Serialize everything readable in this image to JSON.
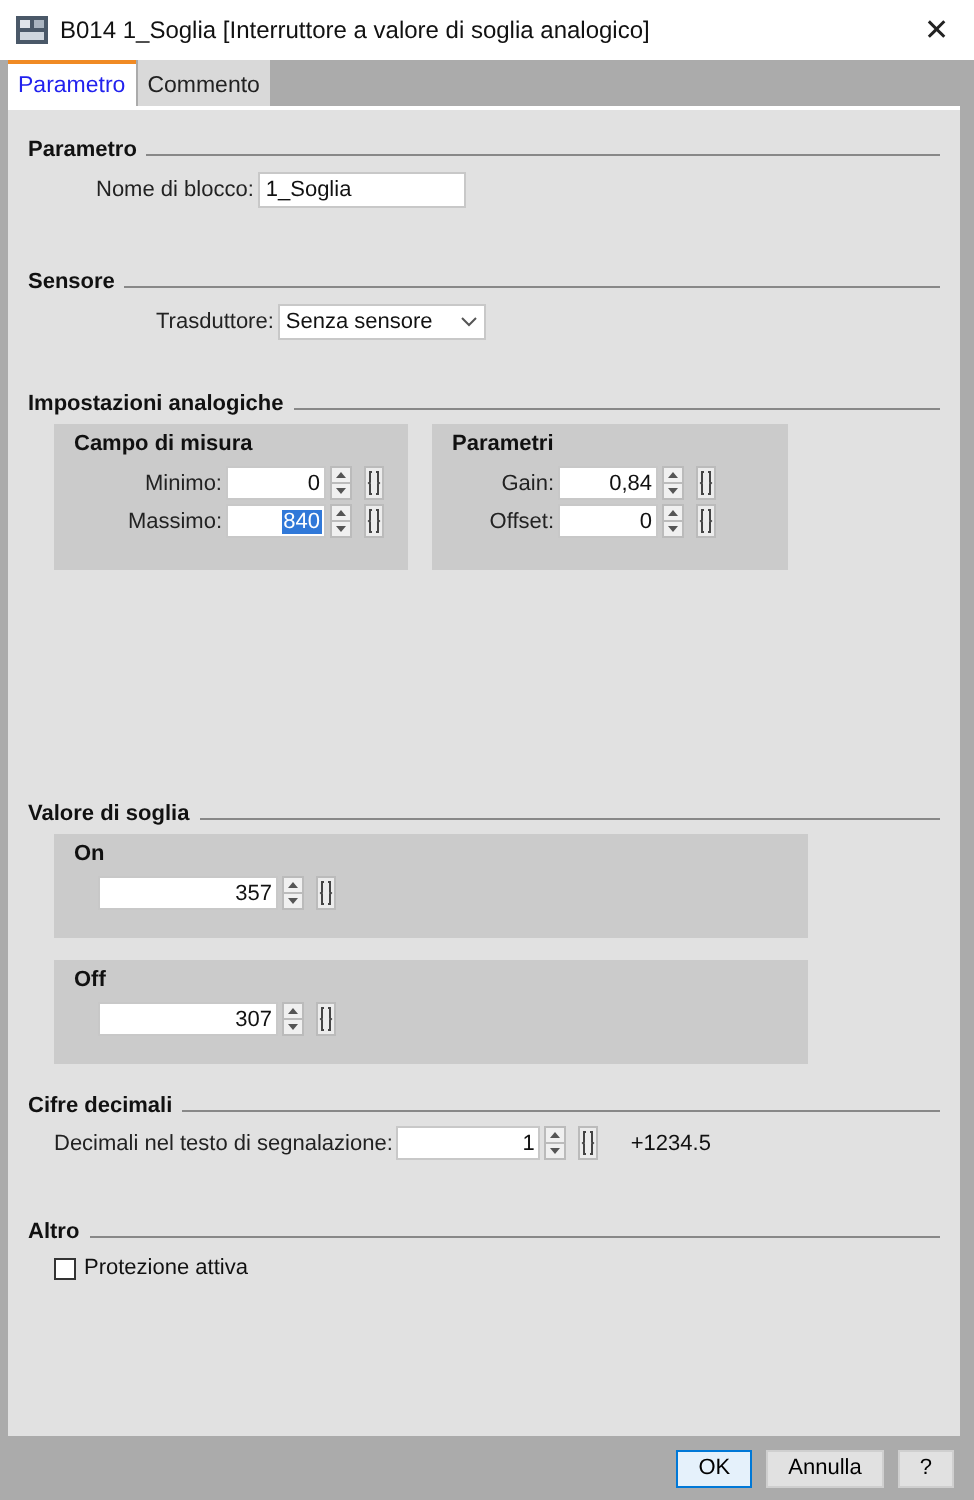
{
  "window": {
    "title": "B014 1_Soglia [Interruttore a valore di soglia analogico]",
    "close": "✕"
  },
  "tabs": [
    {
      "label": "Parametro",
      "selected": true
    },
    {
      "label": "Commento",
      "selected": false
    }
  ],
  "sections": [
    {
      "kind": "name",
      "title": "Parametro",
      "label": "Nome di blocco:",
      "value": "1_Soglia"
    },
    {
      "kind": "select",
      "title": "Sensore",
      "label": "Trasduttore:",
      "value": "Senza sensore"
    },
    {
      "kind": "analog",
      "title": "Impostazioni analogiche",
      "groups": [
        {
          "title": "Campo di misura",
          "fields": [
            {
              "label": "Minimo:",
              "value": "0",
              "highlighted": false
            },
            {
              "label": "Massimo:",
              "value": "840",
              "highlighted": true
            }
          ]
        },
        {
          "title": "Parametri",
          "fields": [
            {
              "label": "Gain:",
              "value": "0,84",
              "highlighted": false
            },
            {
              "label": "Offset:",
              "value": "0",
              "highlighted": false
            }
          ]
        }
      ]
    },
    {
      "kind": "threshold",
      "title": "Valore di soglia",
      "groups": [
        {
          "title": "On",
          "value": "357"
        },
        {
          "title": "Off",
          "value": "307"
        }
      ]
    },
    {
      "kind": "decimals",
      "title": "Cifre decimali",
      "label": "Decimali nel testo di segnalazione:",
      "value": "1",
      "preview": "+1234.5"
    },
    {
      "kind": "options",
      "title": "Altro",
      "options": [
        {
          "label": "Protezione attiva",
          "checked": false
        }
      ]
    }
  ],
  "buttons": [
    {
      "label": "OK",
      "default": true
    },
    {
      "label": "Annulla",
      "default": false
    },
    {
      "label": "?",
      "default": false
    }
  ]
}
